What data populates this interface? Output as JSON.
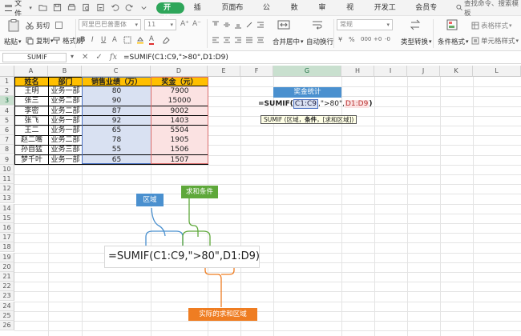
{
  "menubar": {
    "file_label": "文件",
    "tabs": [
      "开始",
      "插入",
      "页面布局",
      "公式",
      "数据",
      "审阅",
      "视图",
      "开发工具",
      "会员专享"
    ],
    "active_tab": "开始",
    "search_text": "查找命令、搜索模板"
  },
  "ribbon": {
    "cut": "剪切",
    "paste": "粘贴",
    "copy": "复制",
    "format_painter": "格式刷",
    "font_name": "阿里巴巴普惠体",
    "font_size": "11",
    "merge": "合并居中",
    "wrap": "自动换行",
    "number_format": "常规",
    "type_convert": "类型转换",
    "cond_format": "条件格式",
    "table_style": "表格样式",
    "cell_style": "单元格样式"
  },
  "formula_bar": {
    "name_box": "SUMIF",
    "formula": "=SUMIF(C1:C9,\">80\",D1:D9)"
  },
  "columns": [
    "A",
    "B",
    "C",
    "D",
    "E",
    "F",
    "G",
    "H",
    "I",
    "J",
    "K",
    "L"
  ],
  "rows": [
    "1",
    "2",
    "3",
    "4",
    "5",
    "6",
    "7",
    "8",
    "9",
    "10",
    "11",
    "12",
    "13",
    "14",
    "15",
    "16",
    "17",
    "18",
    "19",
    "20",
    "21",
    "22",
    "23",
    "24",
    "25",
    "26"
  ],
  "table": {
    "headers": [
      "姓名",
      "部门",
      "销售业绩（万）",
      "奖金（元）"
    ],
    "data": [
      [
        "王明",
        "业务一部",
        "80",
        "7900"
      ],
      [
        "张三",
        "业务二部",
        "90",
        "15000"
      ],
      [
        "李密",
        "业务二部",
        "87",
        "9002"
      ],
      [
        "张飞",
        "业务一部",
        "92",
        "1403"
      ],
      [
        "王二",
        "业务一部",
        "65",
        "5504"
      ],
      [
        "赵二嘴",
        "业务二部",
        "78",
        "1905"
      ],
      [
        "孙自猛",
        "业务三部",
        "55",
        "1506"
      ],
      [
        "梦千叶",
        "业务一部",
        "65",
        "1507"
      ]
    ]
  },
  "bonus_box": {
    "title": "奖金统计",
    "formula_parts": [
      "=SUMIF(",
      "C1:C9",
      ",\">80\",",
      "D1:D9",
      ")"
    ],
    "tooltip_fn": "SUMIF",
    "tooltip_args": "(区域，",
    "tooltip_bold": "条件",
    "tooltip_rest": "，[求和区域])"
  },
  "annotations": {
    "range_label": "区域",
    "criteria_label": "求和条件",
    "sum_range_label": "实际的求和区域",
    "big_formula": "=SUMIF(C1:C9,\">80\",D1:D9)",
    "colors": {
      "range": "#4a90cf",
      "criteria": "#5ea83a",
      "sum_range": "#ef7d22"
    }
  }
}
